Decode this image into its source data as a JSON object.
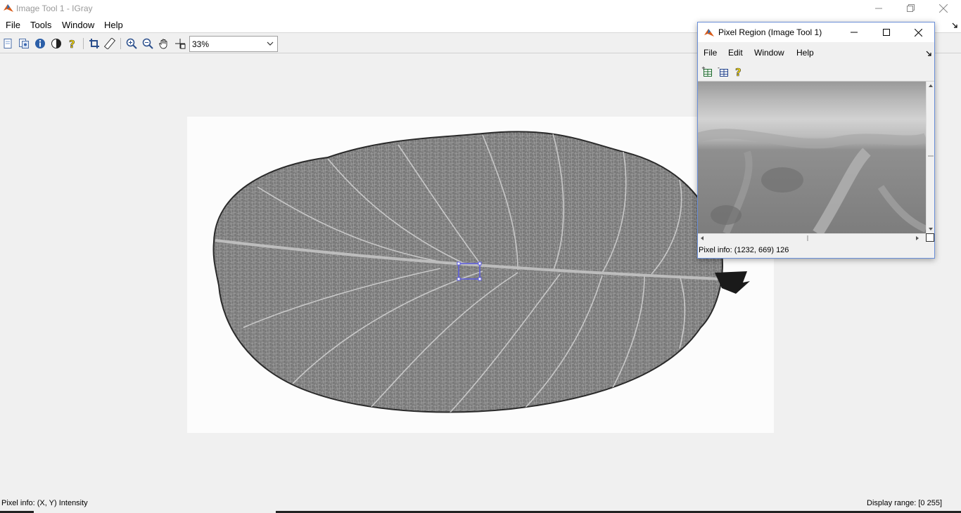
{
  "window": {
    "title": "Image Tool 1 - IGray",
    "menus": [
      "File",
      "Tools",
      "Window",
      "Help"
    ]
  },
  "toolbar": {
    "icons": [
      "new-icon",
      "copy-icon",
      "info-icon",
      "contrast-icon",
      "help-icon",
      "crop-icon",
      "ruler-icon",
      "zoom-in-icon",
      "zoom-out-icon",
      "pan-hand-icon",
      "pixel-region-icon"
    ],
    "zoom": "33%"
  },
  "status": {
    "pixel_info": "Pixel info: (X, Y)  Intensity",
    "display_range": "Display range: [0 255]"
  },
  "pixel_region": {
    "title": "Pixel Region (Image Tool 1)",
    "menus": [
      "File",
      "Edit",
      "Window",
      "Help"
    ],
    "pixel_info": "Pixel info: (1232, 669)  126"
  },
  "colors": {
    "selection": "#5a5ae0",
    "window_border": "#6a8fd8",
    "help_yellow": "#f5d800"
  }
}
